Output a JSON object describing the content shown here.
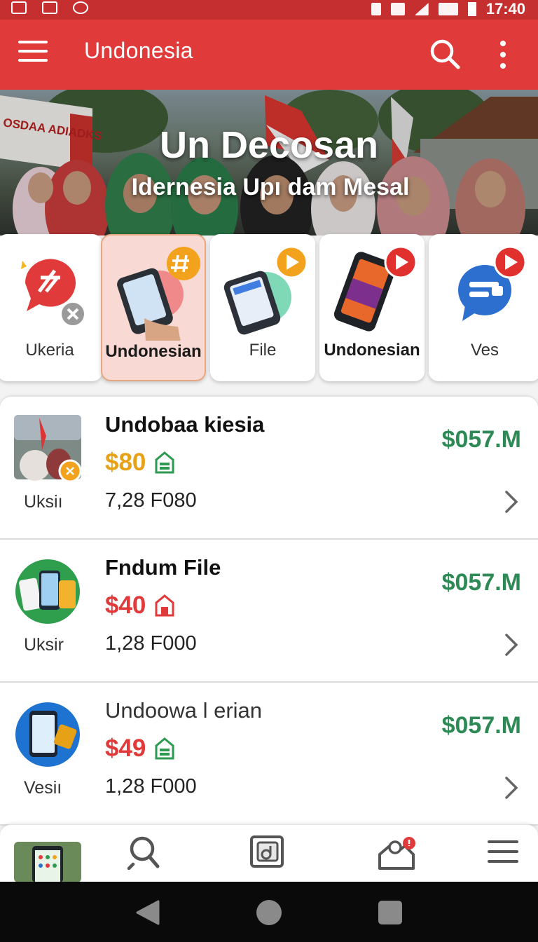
{
  "status_bar": {
    "time": "17:40"
  },
  "app_bar": {
    "title": "Undonesia"
  },
  "hero": {
    "title": "Un Decosan",
    "subtitle": "Idernesia Upı dam Mesal",
    "banner_text": "OSDAA ADIADKS"
  },
  "categories": [
    {
      "label": "Ukeria",
      "icon": "chat-bubble-icon",
      "badge": "close-badge",
      "selected": false
    },
    {
      "label": "Undonesian",
      "icon": "phone-hand-icon",
      "badge": "hashtag-badge",
      "selected": true
    },
    {
      "label": "File",
      "icon": "phone-icon",
      "badge": "play-badge",
      "selected": false
    },
    {
      "label": "Undonesian",
      "icon": "phone-video-icon",
      "badge": "play-badge",
      "selected": false
    },
    {
      "label": "Ves",
      "icon": "message-icon",
      "badge": "play-badge",
      "selected": false
    }
  ],
  "list": [
    {
      "title": "Undobaa kiesia",
      "price": "$80",
      "price_color": "#e7a117",
      "tag_color": "#2f9a4f",
      "meta": "7,28 F080",
      "value": "$057.M",
      "caption": "Uksiı",
      "thumb": "photo-thumb"
    },
    {
      "title": "Fndum File",
      "price": "$40",
      "price_color": "#e03a3a",
      "tag_color": "#e03a3a",
      "meta": "1,28 F000",
      "value": "$057.M",
      "caption": "Uksir",
      "thumb": "phones-thumb"
    },
    {
      "title": "Undoowa l erian",
      "price": "$49",
      "price_color": "#e03a3a",
      "tag_color": "#2f9a4f",
      "meta": "1,28 F000",
      "value": "$057.M",
      "caption": "Vesiı",
      "thumb": "phone-blue-thumb"
    }
  ],
  "bottom_nav": {
    "items": [
      "home-thumb",
      "search-icon",
      "gallery-icon",
      "profile-icon",
      "menu-icon"
    ]
  },
  "colors": {
    "primary": "#e03a3a",
    "value_green": "#2e8a55",
    "accent_orange": "#e7a117"
  }
}
